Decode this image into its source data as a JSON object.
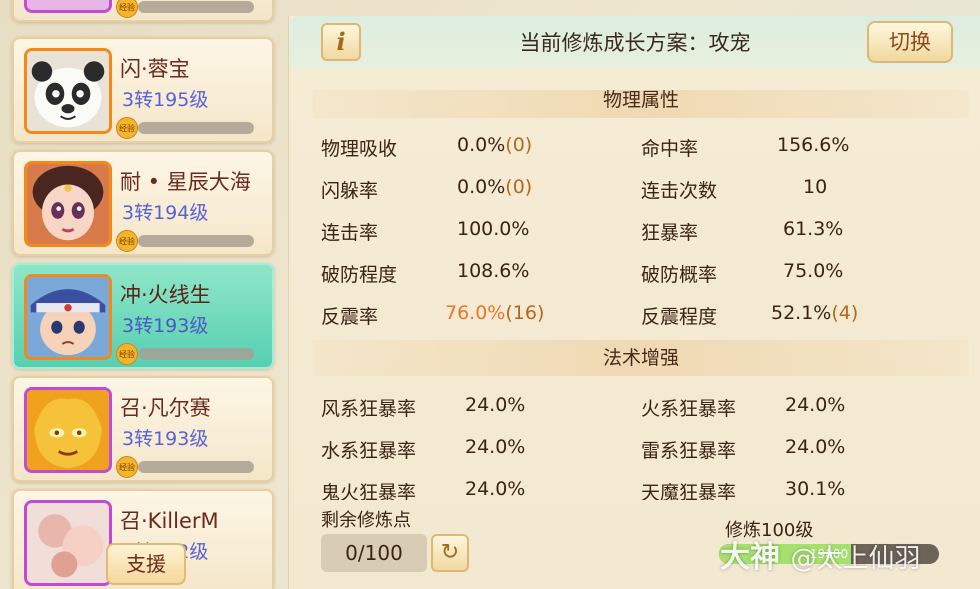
{
  "roster": {
    "exp_icon_label": "经验",
    "support_label": "支援",
    "cards": [
      {
        "name": "",
        "level": ""
      },
      {
        "name": "闪·蓉宝",
        "level": "3转195级"
      },
      {
        "name": "耐 • 星辰大海",
        "level": "3转194级"
      },
      {
        "name": "冲·火线生",
        "level": "3转193级",
        "active": true
      },
      {
        "name": "召·凡尔赛",
        "level": "3转193级"
      },
      {
        "name": "召·KillerM",
        "level": "3转192级"
      }
    ]
  },
  "header": {
    "info_icon": "i",
    "title": "当前修炼成长方案：攻宠",
    "switch_label": "切换"
  },
  "physical": {
    "title": "物理属性",
    "stats": [
      {
        "label": "物理吸收",
        "value": "0.0%",
        "extra": "(0)"
      },
      {
        "label": "命中率",
        "value": "156.6%",
        "extra": ""
      },
      {
        "label": "闪躲率",
        "value": "0.0%",
        "extra": "(0)"
      },
      {
        "label": "连击次数",
        "value": "10",
        "extra": ""
      },
      {
        "label": "连击率",
        "value": "100.0%",
        "extra": ""
      },
      {
        "label": "狂暴率",
        "value": "61.3%",
        "extra": ""
      },
      {
        "label": "破防程度",
        "value": "108.6%",
        "extra": ""
      },
      {
        "label": "破防概率",
        "value": "75.0%",
        "extra": ""
      },
      {
        "label": "反震率",
        "value": "76.0%",
        "extra": "(16)",
        "highlight": "#e8762a"
      },
      {
        "label": "反震程度",
        "value": "52.1%",
        "extra": "(4)"
      }
    ]
  },
  "magic": {
    "title": "法术增强",
    "stats": [
      {
        "label": "风系狂暴率",
        "value": "24.0%"
      },
      {
        "label": "火系狂暴率",
        "value": "24.0%"
      },
      {
        "label": "水系狂暴率",
        "value": "24.0%"
      },
      {
        "label": "雷系狂暴率",
        "value": "24.0%"
      },
      {
        "label": "鬼火狂暴率",
        "value": "24.0%"
      },
      {
        "label": "天魔狂暴率",
        "value": "30.1%"
      }
    ]
  },
  "footer": {
    "remain_label": "剩余修炼点",
    "remain_value": "0/100",
    "refresh_icon": "↻",
    "cult_level": "修炼100级",
    "cult_bar_text": "19000",
    "cult_progress": 0.6
  },
  "watermark": {
    "brand": "大神",
    "user": "@太上仙羽"
  },
  "colors": {
    "accent": "#5a61d8",
    "highlight": "#e8762a",
    "active_card": "#58cfb1"
  }
}
